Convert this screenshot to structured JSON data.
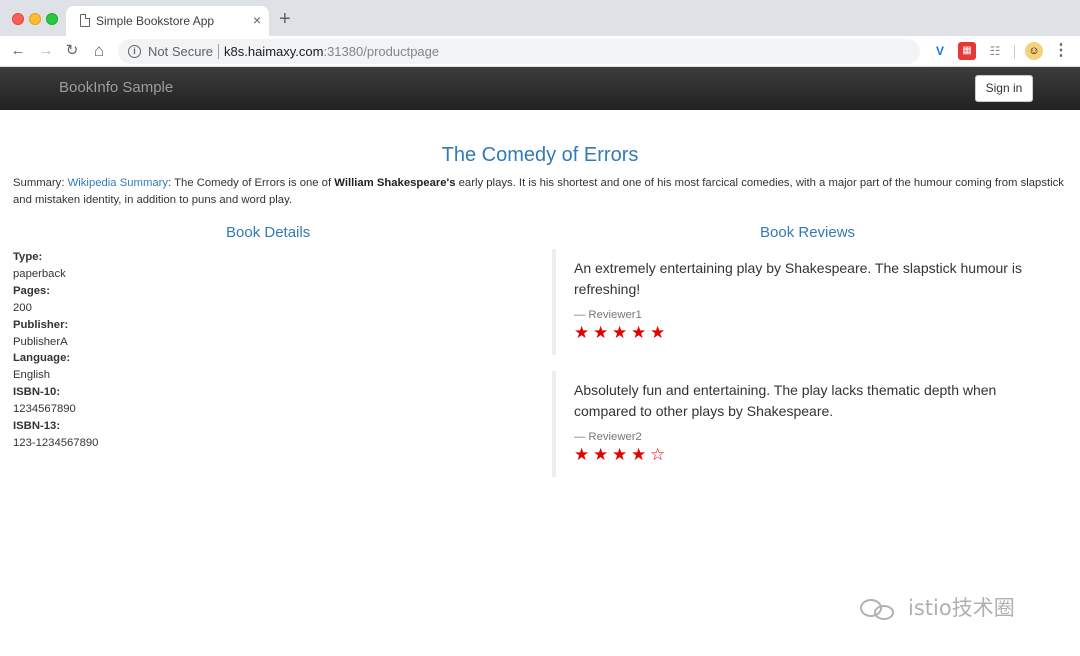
{
  "browser": {
    "tab_title": "Simple Bookstore App",
    "tab_close": "×",
    "new_tab": "+",
    "back": "←",
    "forward": "→",
    "reload": "↻",
    "home": "⌂",
    "not_secure": "Not Secure",
    "url_host": "k8s.haimaxy.com",
    "url_rest": ":31380/productpage"
  },
  "navbar": {
    "brand": "BookInfo Sample",
    "sign_in": "Sign in"
  },
  "book": {
    "title": "The Comedy of Errors",
    "summary_prefix": "Summary: ",
    "summary_link": "Wikipedia Summary",
    "summary_mid": ": The Comedy of Errors is one of ",
    "summary_bold": "William Shakespeare's",
    "summary_rest": " early plays. It is his shortest and one of his most farcical comedies, with a major part of the humour coming from slapstick and mistaken identity, in addition to puns and word play."
  },
  "details": {
    "heading": "Book Details",
    "type_label": "Type:",
    "type": "paperback",
    "pages_label": "Pages:",
    "pages": "200",
    "publisher_label": "Publisher:",
    "publisher": "PublisherA",
    "language_label": "Language:",
    "language": "English",
    "isbn10_label": "ISBN-10:",
    "isbn10": "1234567890",
    "isbn13_label": "ISBN-13:",
    "isbn13": "123-1234567890"
  },
  "reviews": {
    "heading": "Book Reviews",
    "items": [
      {
        "text": "An extremely entertaining play by Shakespeare. The slapstick humour is refreshing!",
        "reviewer": "— Reviewer1",
        "rating": 5
      },
      {
        "text": "Absolutely fun and entertaining. The play lacks thematic depth when compared to other plays by Shakespeare.",
        "reviewer": "— Reviewer2",
        "rating": 4
      }
    ],
    "star_color": "#e00000"
  },
  "watermark": "istio技术圈"
}
